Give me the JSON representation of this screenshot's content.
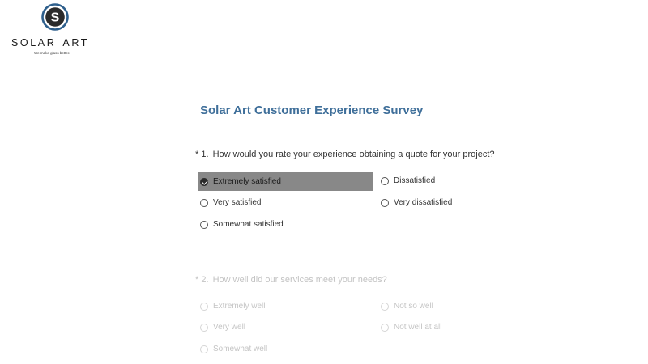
{
  "brand": {
    "logo_letter": "S",
    "name_left": "SOLAR",
    "name_right": "ART",
    "tagline": "We make glass better."
  },
  "survey": {
    "title": "Solar Art Customer Experience Survey",
    "questions": [
      {
        "required_mark": "*",
        "number": "1.",
        "text": "How would you rate your experience obtaining a quote for your project?",
        "selected": "Extremely satisfied",
        "options": [
          "Extremely satisfied",
          "Very satisfied",
          "Somewhat satisfied",
          "Dissatisfied",
          "Very dissatisfied"
        ]
      },
      {
        "required_mark": "*",
        "number": "2.",
        "text": "How well did our services meet your needs?",
        "selected": null,
        "options": [
          "Extremely well",
          "Very well",
          "Somewhat well",
          "Not so well",
          "Not well at all"
        ]
      }
    ]
  },
  "colors": {
    "title": "#3f6f9a",
    "logo_blue": "#2e5f8c",
    "selected_bg": "#888888",
    "faded_text": "#c5c5c5"
  },
  "icons": {
    "logo": "circle-s-logo-icon",
    "radio": "radio-circle-icon",
    "radio_checked": "check-circle-icon"
  }
}
